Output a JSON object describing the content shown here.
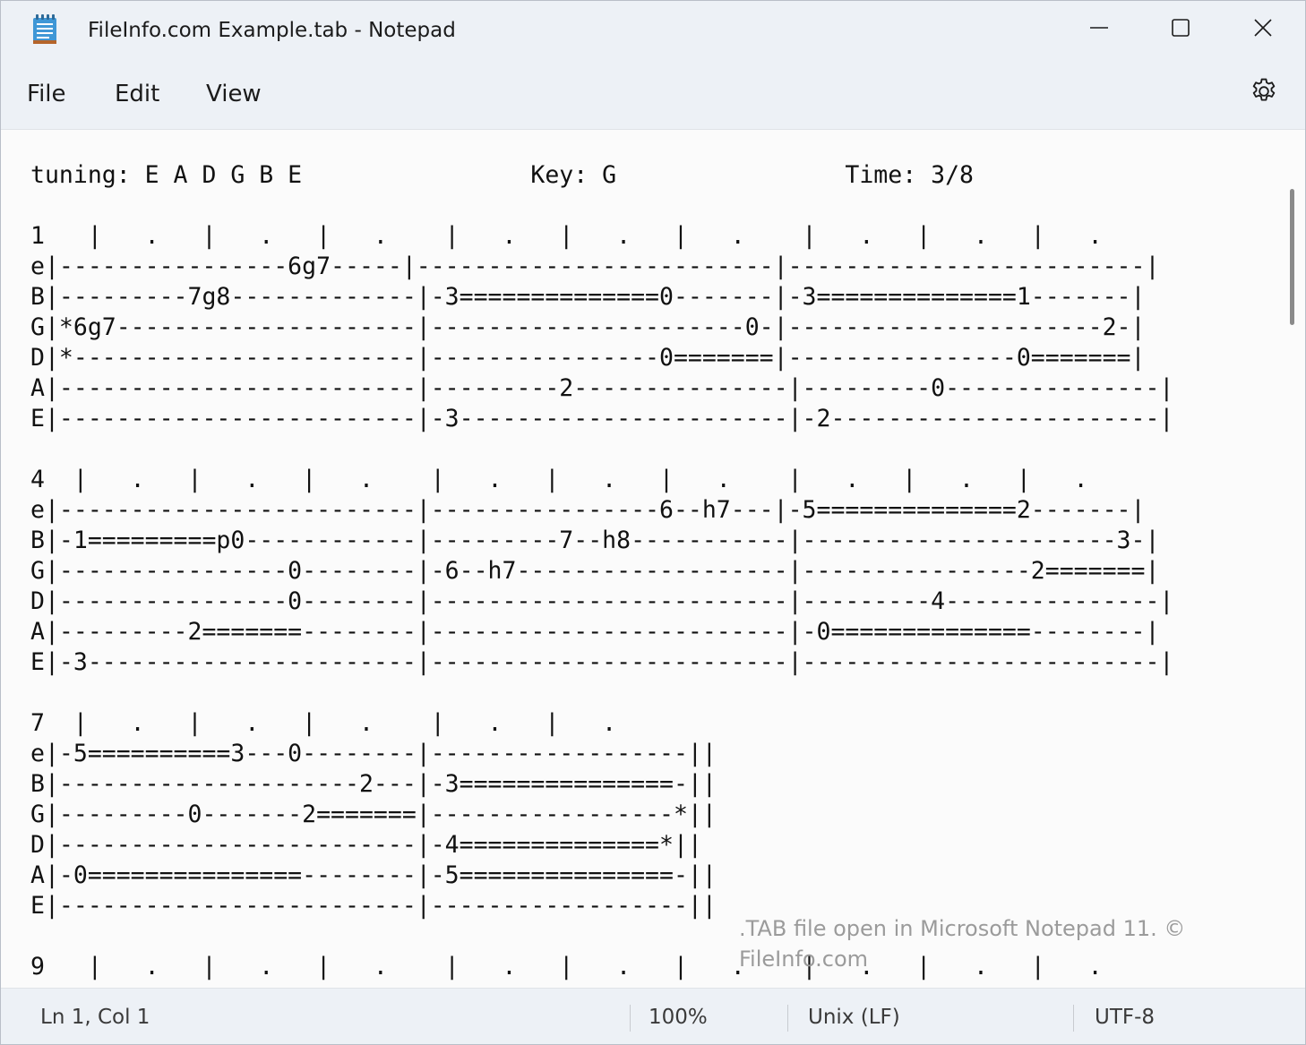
{
  "window": {
    "title": "FileInfo.com Example.tab - Notepad",
    "minimize_icon": "minimize-icon",
    "maximize_icon": "maximize-icon",
    "close_icon": "close-icon"
  },
  "menu": {
    "items": [
      {
        "label": "File"
      },
      {
        "label": "Edit"
      },
      {
        "label": "View"
      }
    ],
    "settings_icon": "gear-icon"
  },
  "editor": {
    "lines": [
      "tuning: E A D G B E                Key: G                Time: 3/8",
      "",
      "1   |   .   |   .   |   .    |   .   |   .   |   .    |   .   |   .   |   .",
      "e|----------------6g7-----|-------------------------|-------------------------|",
      "B|---------7g8-------------|-3==============0-------|-3==============1-------|",
      "G|*6g7---------------------|----------------------0-|----------------------2-|",
      "D|*------------------------|----------------0=======|----------------0=======|",
      "A|-------------------------|---------2---------------|---------0---------------|",
      "E|-------------------------|-3-----------------------|-2-----------------------|",
      "",
      "4  |   .   |   .   |   .    |   .   |   .   |   .    |   .   |   .   |   .",
      "e|-------------------------|----------------6--h7---|-5==============2-------|",
      "B|-1=========p0------------|---------7--h8-----------|----------------------3-|",
      "G|----------------0--------|-6--h7-------------------|----------------2=======|",
      "D|----------------0--------|-------------------------|---------4---------------|",
      "A|---------2=======--------|-------------------------|-0==============--------|",
      "E|-3-----------------------|-------------------------|-------------------------|",
      "",
      "7  |   .   |   .   |   .    |   .   |   .",
      "e|-5==========3---0--------|------------------||",
      "B|---------------------2---|-3===============-||",
      "G|---------0-------2=======|-----------------*||",
      "D|-------------------------|-4==============*||",
      "A|-0===============--------|-5===============-||",
      "E|-------------------------|------------------||",
      "",
      "9   |   .   |   .   |   .    |   .   |   .   |   .    |   .   |   .   |   ."
    ],
    "watermark": ".TAB file open in Microsoft Notepad 11. © FileInfo.com"
  },
  "status": {
    "position": "Ln 1, Col 1",
    "zoom": "100%",
    "line_ending": "Unix (LF)",
    "encoding": "UTF-8"
  },
  "colors": {
    "chrome": "#edf1f6",
    "editor_bg": "#fbfbfb",
    "text": "#111111",
    "watermark": "#9b9b9b"
  }
}
